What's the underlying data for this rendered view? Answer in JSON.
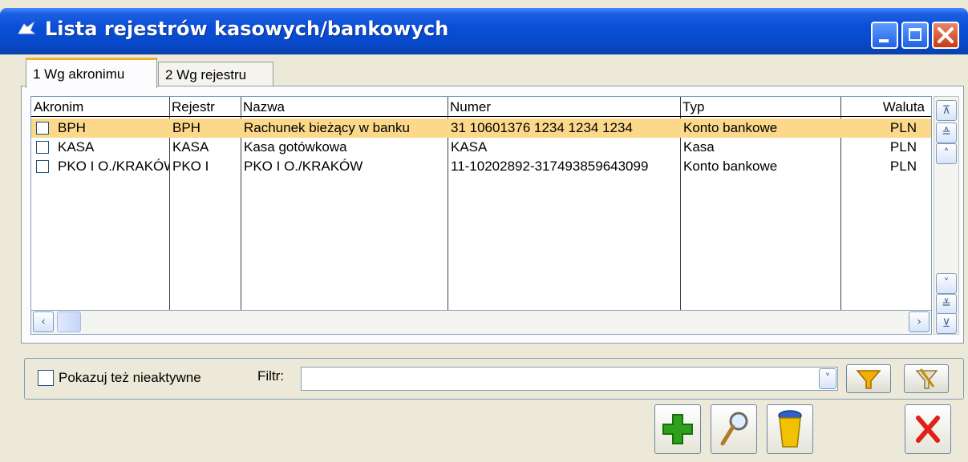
{
  "window": {
    "title": "Lista rejestrów kasowych/bankowych"
  },
  "tabs": [
    {
      "label": "1 Wg akronimu",
      "active": true
    },
    {
      "label": "2 Wg rejestru",
      "active": false
    }
  ],
  "table": {
    "columns": [
      "Akronim",
      "Rejestr",
      "Nazwa",
      "Numer",
      "Typ",
      "Waluta"
    ],
    "rows": [
      {
        "akronim": "BPH",
        "rejestr": "BPH",
        "nazwa": "Rachunek bieżący w banku",
        "numer": "31 10601376 1234 1234 1234",
        "typ": "Konto bankowe",
        "waluta": "PLN",
        "selected": true
      },
      {
        "akronim": "KASA",
        "rejestr": "KASA",
        "nazwa": "Kasa gotówkowa",
        "numer": "KASA",
        "typ": "Kasa",
        "waluta": "PLN",
        "selected": false
      },
      {
        "akronim": "PKO I O./KRAKÓW",
        "rejestr": "PKO I",
        "nazwa": "PKO I O./KRAKÓW",
        "numer": "11-10202892-317493859643099",
        "typ": "Konto bankowe",
        "waluta": "PLN",
        "selected": false
      }
    ]
  },
  "filter": {
    "show_inactive_label": "Pokazuj też nieaktywne",
    "filter_label": "Filtr:",
    "filter_value": ""
  },
  "icons": {
    "title": "app-icon",
    "add": "add-icon",
    "preview": "magnifier-icon",
    "delete": "trash-icon",
    "close": "close-icon",
    "filter_apply": "funnel-icon",
    "filter_clear": "funnel-clear-icon"
  },
  "colors": {
    "title_bar": "#0a4fd8",
    "selected_row": "#fcd88a",
    "tab_active_accent": "#f0b030",
    "add_green": "#2ea01c",
    "close_red": "#e0201a"
  }
}
